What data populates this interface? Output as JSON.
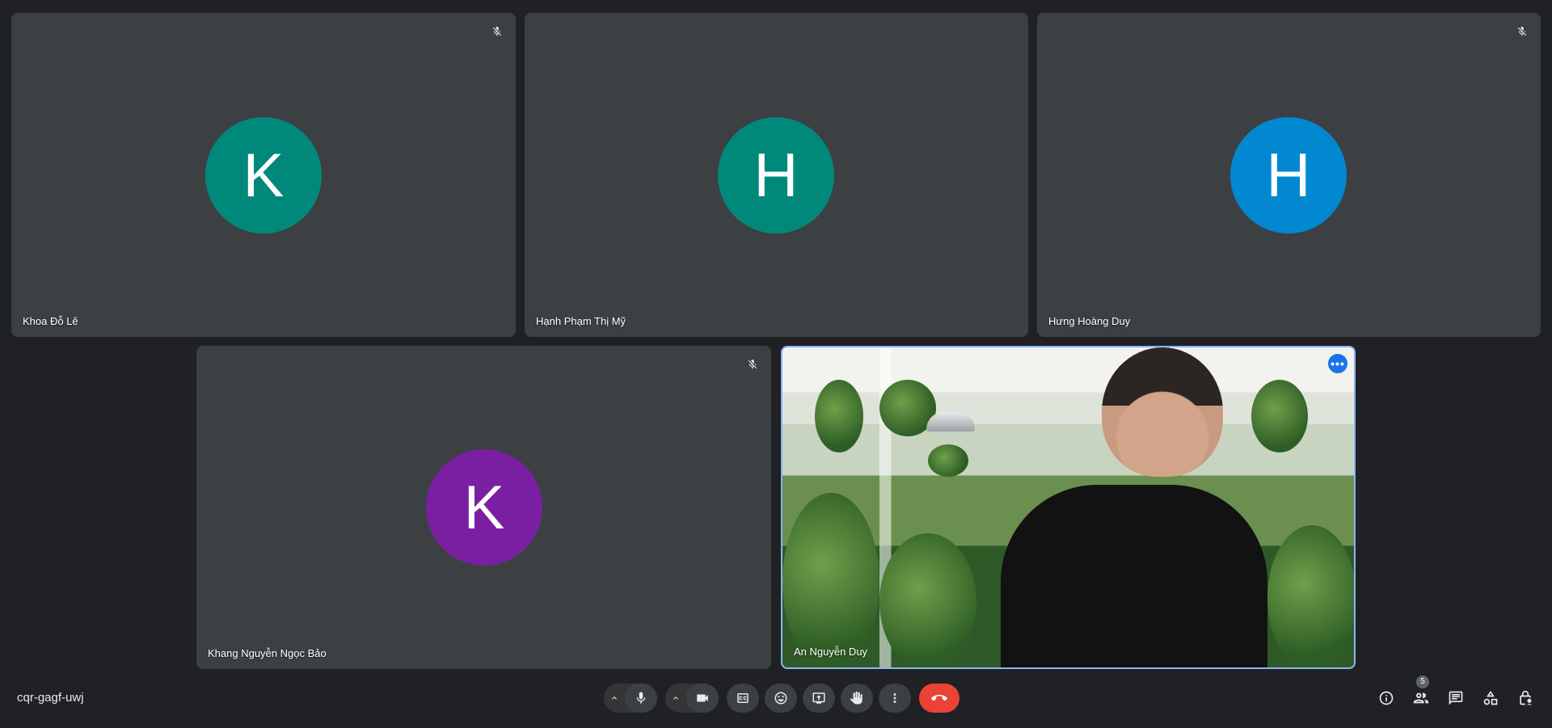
{
  "participants": [
    {
      "name": "Khoa Đỗ Lê",
      "initial": "K",
      "color": "#00897b",
      "muted": true
    },
    {
      "name": "Hạnh Phạm Thị Mỹ",
      "initial": "H",
      "color": "#00897b",
      "muted": false
    },
    {
      "name": "Hưng Hoàng Duy",
      "initial": "H",
      "color": "#0288d1",
      "muted": true
    },
    {
      "name": "Khang Nguyễn Ngọc Bảo",
      "initial": "K",
      "color": "#7b1fa2",
      "muted": true
    },
    {
      "name": "An Nguyễn Duy",
      "self_view": true,
      "more_options_icon": "more-horiz-icon"
    }
  ],
  "meeting": {
    "code": "cqr-gagf-uwj"
  },
  "controls": {
    "mic_icon": "mic-icon",
    "camera_icon": "videocam-icon",
    "captions_icon": "closed-caption-icon",
    "reactions_icon": "emoji-icon",
    "present_icon": "present-screen-icon",
    "hand_icon": "raise-hand-icon",
    "more_icon": "more-vert-icon",
    "end_call_icon": "call-end-icon",
    "end_call_color": "#ea4335"
  },
  "side_controls": {
    "info_icon": "info-icon",
    "people_icon": "people-icon",
    "people_count": "5",
    "chat_icon": "chat-icon",
    "activities_icon": "activities-icon",
    "host_controls_icon": "lock-person-icon"
  }
}
